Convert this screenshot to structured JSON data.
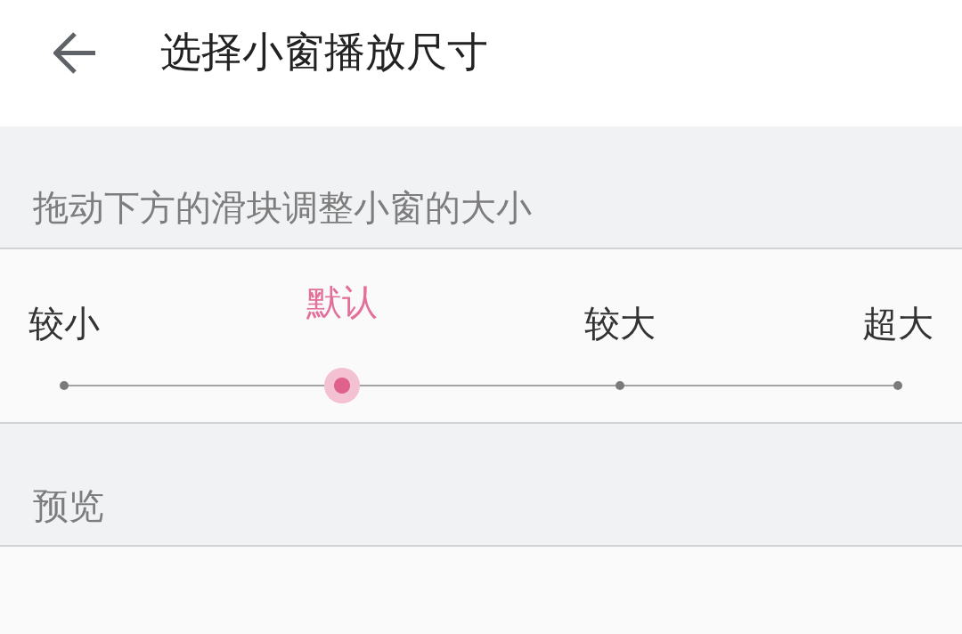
{
  "header": {
    "title": "选择小窗播放尺寸"
  },
  "hint": "拖动下方的滑块调整小窗的大小",
  "size_slider": {
    "stops": [
      {
        "label": "较小",
        "selected": false
      },
      {
        "label": "默认",
        "selected": true
      },
      {
        "label": "较大",
        "selected": false
      },
      {
        "label": "超大",
        "selected": false
      }
    ]
  },
  "preview": {
    "title": "预览"
  }
}
